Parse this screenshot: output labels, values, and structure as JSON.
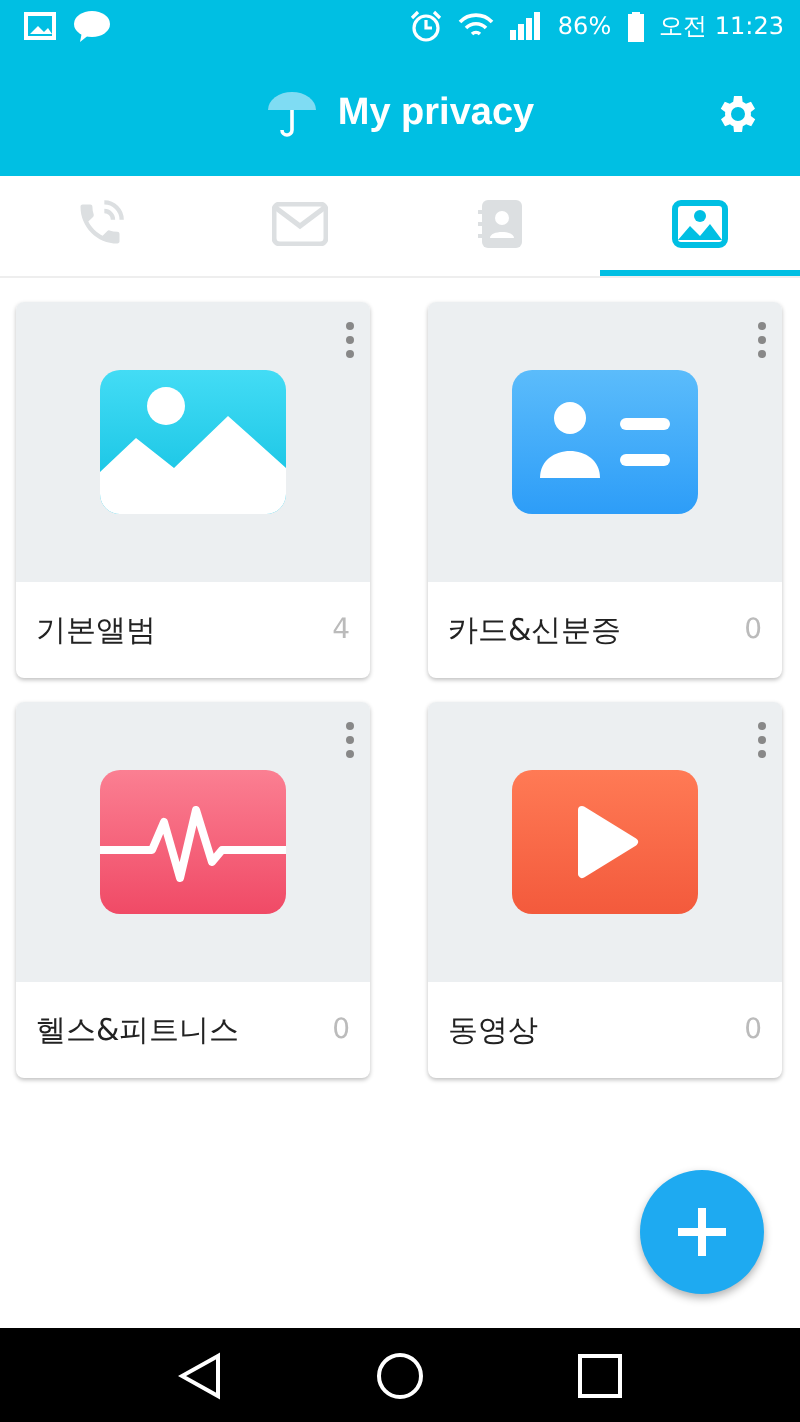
{
  "status_bar": {
    "battery": "86%",
    "time": "오전 11:23"
  },
  "header": {
    "title": "My privacy"
  },
  "tabs": [
    {
      "kind": "calls",
      "selected": false
    },
    {
      "kind": "messages",
      "selected": false
    },
    {
      "kind": "contacts",
      "selected": false
    },
    {
      "kind": "gallery",
      "selected": true
    }
  ],
  "albums": [
    {
      "kind": "photo",
      "name": "기본앨범",
      "count": "4"
    },
    {
      "kind": "id",
      "name": "카드&신분증",
      "count": "0"
    },
    {
      "kind": "health",
      "name": "헬스&피트니스",
      "count": "0"
    },
    {
      "kind": "video",
      "name": "동영상",
      "count": "0"
    }
  ]
}
